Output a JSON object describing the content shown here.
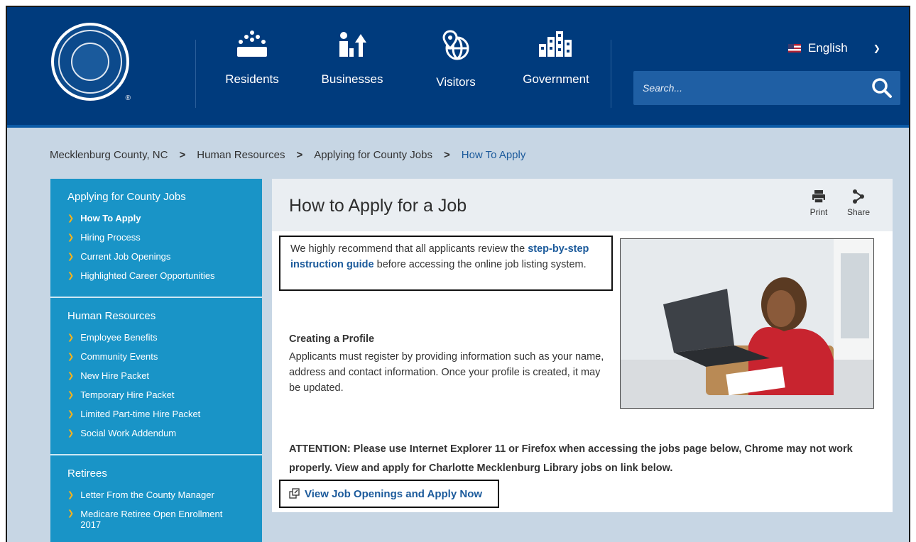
{
  "header": {
    "nav": [
      {
        "label": "Residents"
      },
      {
        "label": "Businesses"
      },
      {
        "label": "Visitors"
      },
      {
        "label": "Government"
      }
    ],
    "language": "English",
    "search_placeholder": "Search..."
  },
  "breadcrumb": [
    "Mecklenburg County, NC",
    "Human Resources",
    "Applying for County Jobs",
    "How To Apply"
  ],
  "sidebar": {
    "sections": [
      {
        "title": "Applying for County Jobs",
        "items": [
          "How To Apply",
          "Hiring Process",
          "Current Job Openings",
          "Highlighted Career Opportunities"
        ]
      },
      {
        "title": "Human Resources",
        "items": [
          "Employee Benefits",
          "Community Events",
          "New Hire Packet",
          "Temporary Hire Packet",
          "Limited Part-time Hire Packet",
          "Social Work Addendum"
        ]
      },
      {
        "title": "Retirees",
        "items": [
          "Letter From the County Manager",
          "Medicare Retiree Open Enrollment 2017"
        ]
      }
    ]
  },
  "main": {
    "title": "How to Apply for a Job",
    "tools": {
      "print": "Print",
      "share": "Share"
    },
    "intro_pre": "We highly recommend that all applicants review the ",
    "intro_link": "step-by-step instruction guide",
    "intro_post": " before accessing the online job listing system.",
    "profile_title": "Creating a Profile",
    "profile_body": "Applicants must register by providing information such as your name, address and contact information. Once your profile is created, it may be updated.",
    "attention": "ATTENTION: Please use Internet Explorer 11 or Firefox when accessing the jobs page below, Chrome may not work properly.   View and apply for Charlotte Mecklenburg Library jobs on link below.",
    "apply_link": "View Job Openings and Apply Now"
  }
}
